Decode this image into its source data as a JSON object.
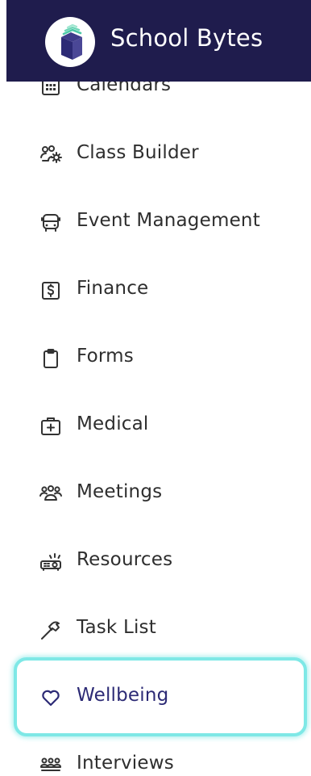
{
  "brand": {
    "name": "School Bytes",
    "header_color": "#1f1c4d",
    "logo_icon": "school-bytes-book-logo"
  },
  "nav": {
    "items": [
      {
        "label": "Calendars",
        "icon": "calendar-icon",
        "active": false
      },
      {
        "label": "Class Builder",
        "icon": "class-builder-icon",
        "active": false
      },
      {
        "label": "Event Management",
        "icon": "bus-icon",
        "active": false
      },
      {
        "label": "Finance",
        "icon": "dollar-icon",
        "active": false
      },
      {
        "label": "Forms",
        "icon": "clipboard-icon",
        "active": false
      },
      {
        "label": "Medical",
        "icon": "medical-kit-icon",
        "active": false
      },
      {
        "label": "Meetings",
        "icon": "people-group-icon",
        "active": false
      },
      {
        "label": "Resources",
        "icon": "projector-icon",
        "active": false
      },
      {
        "label": "Task List",
        "icon": "hammer-icon",
        "active": false
      },
      {
        "label": "Wellbeing",
        "icon": "heart-icon",
        "active": true
      },
      {
        "label": "Interviews",
        "icon": "interview-icon",
        "active": false
      }
    ],
    "active_color": "#2c2a75",
    "highlight_color": "#7ee8e6"
  }
}
